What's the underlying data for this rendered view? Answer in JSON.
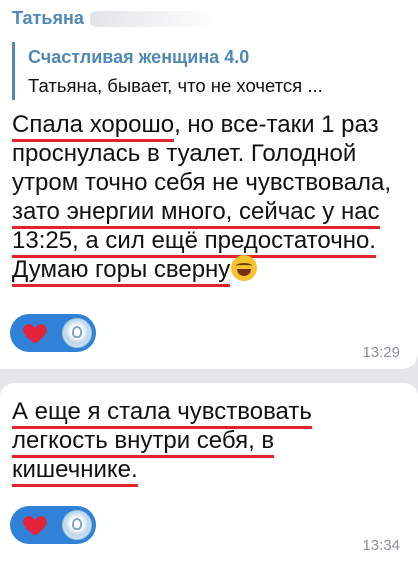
{
  "messages": [
    {
      "sender": "Татьяна",
      "reply": {
        "title": "Счастливая женщина 4.0",
        "text": "Татьяна, бывает, что не хочется ..."
      },
      "lines": [
        {
          "u": "Спала хорошо",
          "rest": ", но все-таки 1 раз"
        },
        {
          "plain": "проснулась в туалет. Голодной"
        },
        {
          "plain": "утром точно себя не чувствовала,"
        },
        {
          "u": "зато  энергии много, сейчас у нас"
        },
        {
          "u": "13:25, а сил ещё предостаточно."
        },
        {
          "u": "Думаю горы сверну",
          "emoji": "rolling-on-floor-laughing-emoji"
        }
      ],
      "reactions": [
        {
          "icon": "heart-icon",
          "color": "#e5243b"
        },
        {
          "icon": "avatar",
          "color": "#2f82d8"
        }
      ],
      "time": "13:29"
    },
    {
      "lines": [
        {
          "u": "А еще я стала чувствовать"
        },
        {
          "u": "легкость внутри себя, в"
        },
        {
          "u": "кишечнике."
        }
      ],
      "reactions": [
        {
          "icon": "heart-icon",
          "color": "#e5243b"
        },
        {
          "icon": "avatar",
          "color": "#2f82d8"
        }
      ],
      "time": "13:34"
    }
  ],
  "colors": {
    "background": "#e4e6e9",
    "bubble": "#ffffff",
    "accent": "#4f88b8",
    "underline": "#e2242a",
    "reaction_pill": "#2f82d8",
    "time": "#8a9096"
  }
}
